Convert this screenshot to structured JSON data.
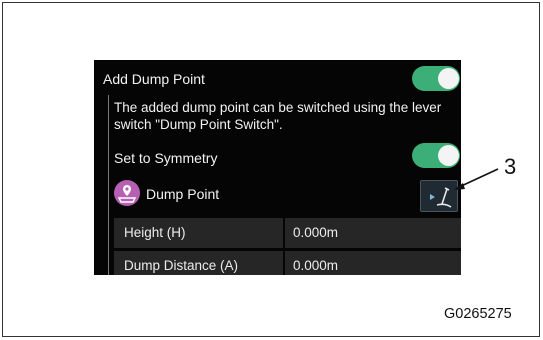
{
  "panel": {
    "add_dump_point_label": "Add Dump Point",
    "description": "The added dump point can be switched using the lever switch \"Dump Point Switch\".",
    "set_symmetry_label": "Set to Symmetry",
    "dump_point_label": "Dump Point",
    "fields": [
      {
        "label": "Height (H)",
        "value": "0.000m"
      },
      {
        "label": "Dump Distance (A)",
        "value": "0.000m"
      }
    ],
    "add_dump_point_toggle_on": true,
    "set_symmetry_toggle_on": true,
    "toggle_color": "#3cae78",
    "dump_point_icon": "dump-point-icon",
    "lever_switch_icon": "lever-switch-icon"
  },
  "annotation": {
    "callout_number": "3",
    "figure_id": "G0265275"
  }
}
